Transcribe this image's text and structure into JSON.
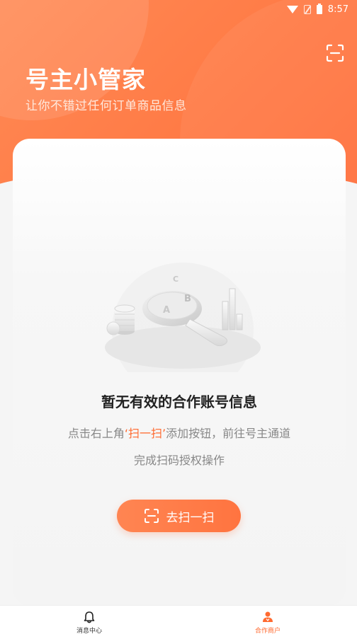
{
  "status_bar": {
    "time": "8:57"
  },
  "header": {
    "title": "号主小管家",
    "subtitle": "让你不错过任何订单商品信息",
    "scan_icon": "scan-icon"
  },
  "empty_state": {
    "title": "暂无有效的合作账号信息",
    "desc_line1_prefix": "点击右上角",
    "desc_line1_highlight": "‘扫一扫’",
    "desc_line1_suffix": "添加按钮，前往号主通道",
    "desc_line2": "完成扫码授权操作",
    "illustration_letters": [
      "C",
      "B",
      "A"
    ]
  },
  "scan_button": {
    "label": "去扫一扫",
    "icon": "scan-icon"
  },
  "tabbar": {
    "items": [
      {
        "label": "消息中心",
        "icon": "bell-icon",
        "active": false
      },
      {
        "label": "合作商户",
        "icon": "merchant-icon",
        "active": true
      }
    ]
  },
  "colors": {
    "accent": "#ff7a45",
    "highlight": "#ff6a30"
  }
}
